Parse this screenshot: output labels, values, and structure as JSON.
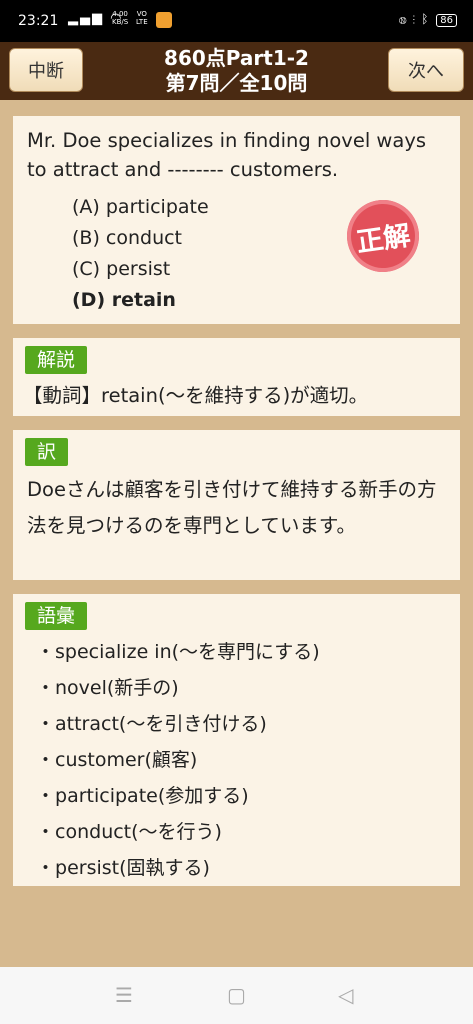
{
  "status_bar": {
    "time": "23:21",
    "speed": "4.00\nKB/S",
    "volte": "VO\nLTE",
    "battery": "86",
    "icons": [
      "signal-icon",
      "wifi-icon",
      "nfc-icon",
      "vibrate-icon",
      "bluetooth-icon",
      "battery-icon"
    ]
  },
  "header": {
    "quit_label": "中断",
    "title_line1": "860点Part1-2",
    "title_line2": "第7問／全10問",
    "next_label": "次へ"
  },
  "question": {
    "text": "Mr. Doe specializes in finding novel ways to attract and -------- customers.",
    "choices": [
      "(A) participate",
      "(B) conduct",
      "(C) persist",
      "(D) retain"
    ],
    "correct_index": 3,
    "stamp_label": "正解"
  },
  "explanation": {
    "label": "解説",
    "text": "【動詞】retain(〜を維持する)が適切。"
  },
  "translation": {
    "label": "訳",
    "text": "Doeさんは顧客を引き付けて維持する新手の方法を見つけるのを専門としています。"
  },
  "vocabulary": {
    "label": "語彙",
    "items": [
      "specialize in(〜を専門にする)",
      "novel(新手の)",
      "attract(〜を引き付ける)",
      "customer(顧客)",
      "participate(参加する)",
      "conduct(〜を行う)",
      "persist(固執する)"
    ]
  },
  "colors": {
    "header_bg": "#4a2a12",
    "label_green": "#56a81e",
    "stamp_red": "#e2505a",
    "card_bg": "#fbf3e6"
  }
}
